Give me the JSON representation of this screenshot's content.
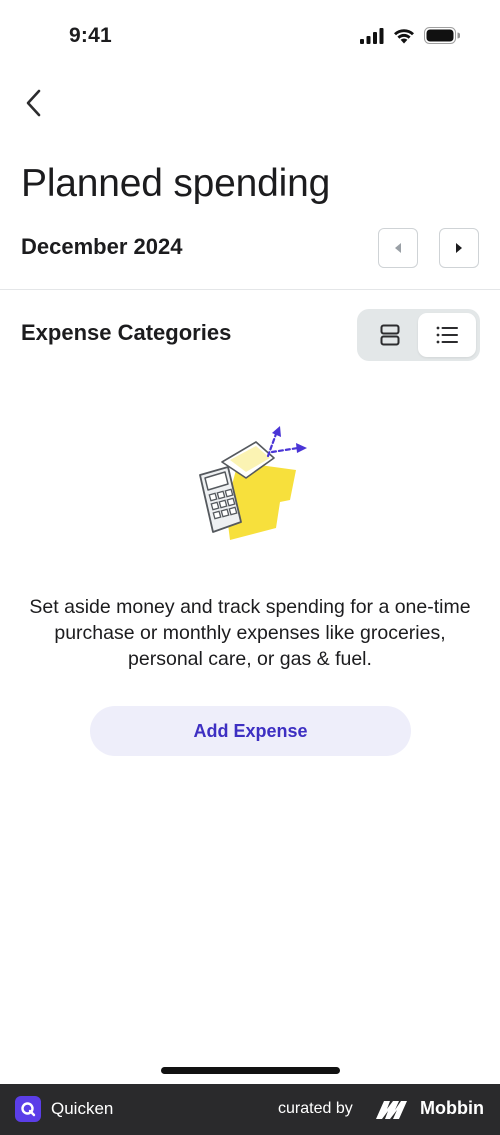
{
  "status_bar": {
    "time": "9:41",
    "icons": [
      "signal-icon",
      "wifi-icon",
      "battery-icon"
    ]
  },
  "header": {
    "back_icon": "chevron-left-icon",
    "title": "Planned spending"
  },
  "period": {
    "label": "December 2024",
    "prev_icon": "triangle-left-icon",
    "next_icon": "triangle-right-icon"
  },
  "section": {
    "title": "Expense Categories",
    "view_toggle": {
      "options": [
        "cards-view-icon",
        "list-view-icon"
      ],
      "selected": "list-view-icon"
    }
  },
  "empty_state": {
    "illustration": "wallet-calculator-illustration",
    "message": "Set aside money and track spending for a one-time purchase or monthly expenses like groceries, personal care, or gas & fuel.",
    "button_label": "Add Expense"
  },
  "footer": {
    "app_name": "Quicken",
    "curated_by": "curated by",
    "brand": "Mobbin"
  },
  "colors": {
    "accent": "#3d2fc2",
    "button_bg": "#eeeefa",
    "illustration_yellow": "#f7e03c",
    "illustration_purple": "#4a35d6",
    "toggle_bg": "#e3e7e8",
    "footer_bg": "#2a2a2c",
    "quicken_brand": "#5b3ee8"
  }
}
